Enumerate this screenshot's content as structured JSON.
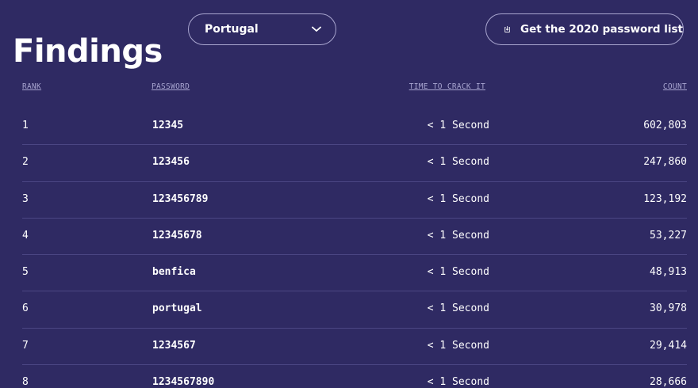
{
  "header": {
    "title": "Findings",
    "country_select": {
      "value": "Portugal"
    },
    "download_button": {
      "label": "Get the 2020 password list"
    }
  },
  "table": {
    "columns": {
      "rank": "RANK",
      "password": "PASSWORD",
      "time": "TIME TO CRACK IT",
      "count": "COUNT"
    },
    "rows": [
      {
        "rank": "1",
        "password": "12345",
        "time": "< 1 Second",
        "count": "602,803"
      },
      {
        "rank": "2",
        "password": "123456",
        "time": "< 1 Second",
        "count": "247,860"
      },
      {
        "rank": "3",
        "password": "123456789",
        "time": "< 1 Second",
        "count": "123,192"
      },
      {
        "rank": "4",
        "password": "12345678",
        "time": "< 1 Second",
        "count": "53,227"
      },
      {
        "rank": "5",
        "password": "benfica",
        "time": "< 1 Second",
        "count": "48,913"
      },
      {
        "rank": "6",
        "password": "portugal",
        "time": "< 1 Second",
        "count": "30,978"
      },
      {
        "rank": "7",
        "password": "1234567",
        "time": "< 1 Second",
        "count": "29,414"
      },
      {
        "rank": "8",
        "password": "1234567890",
        "time": "< 1 Second",
        "count": "28,666"
      }
    ]
  },
  "colors": {
    "background": "#2f2a63",
    "text": "#ffffff",
    "muted": "#a8a5d0",
    "divider": "#4b4683",
    "button_border": "#a9a6cf"
  },
  "icons": {
    "select": "chevron-down-icon",
    "download": "download-icon"
  }
}
